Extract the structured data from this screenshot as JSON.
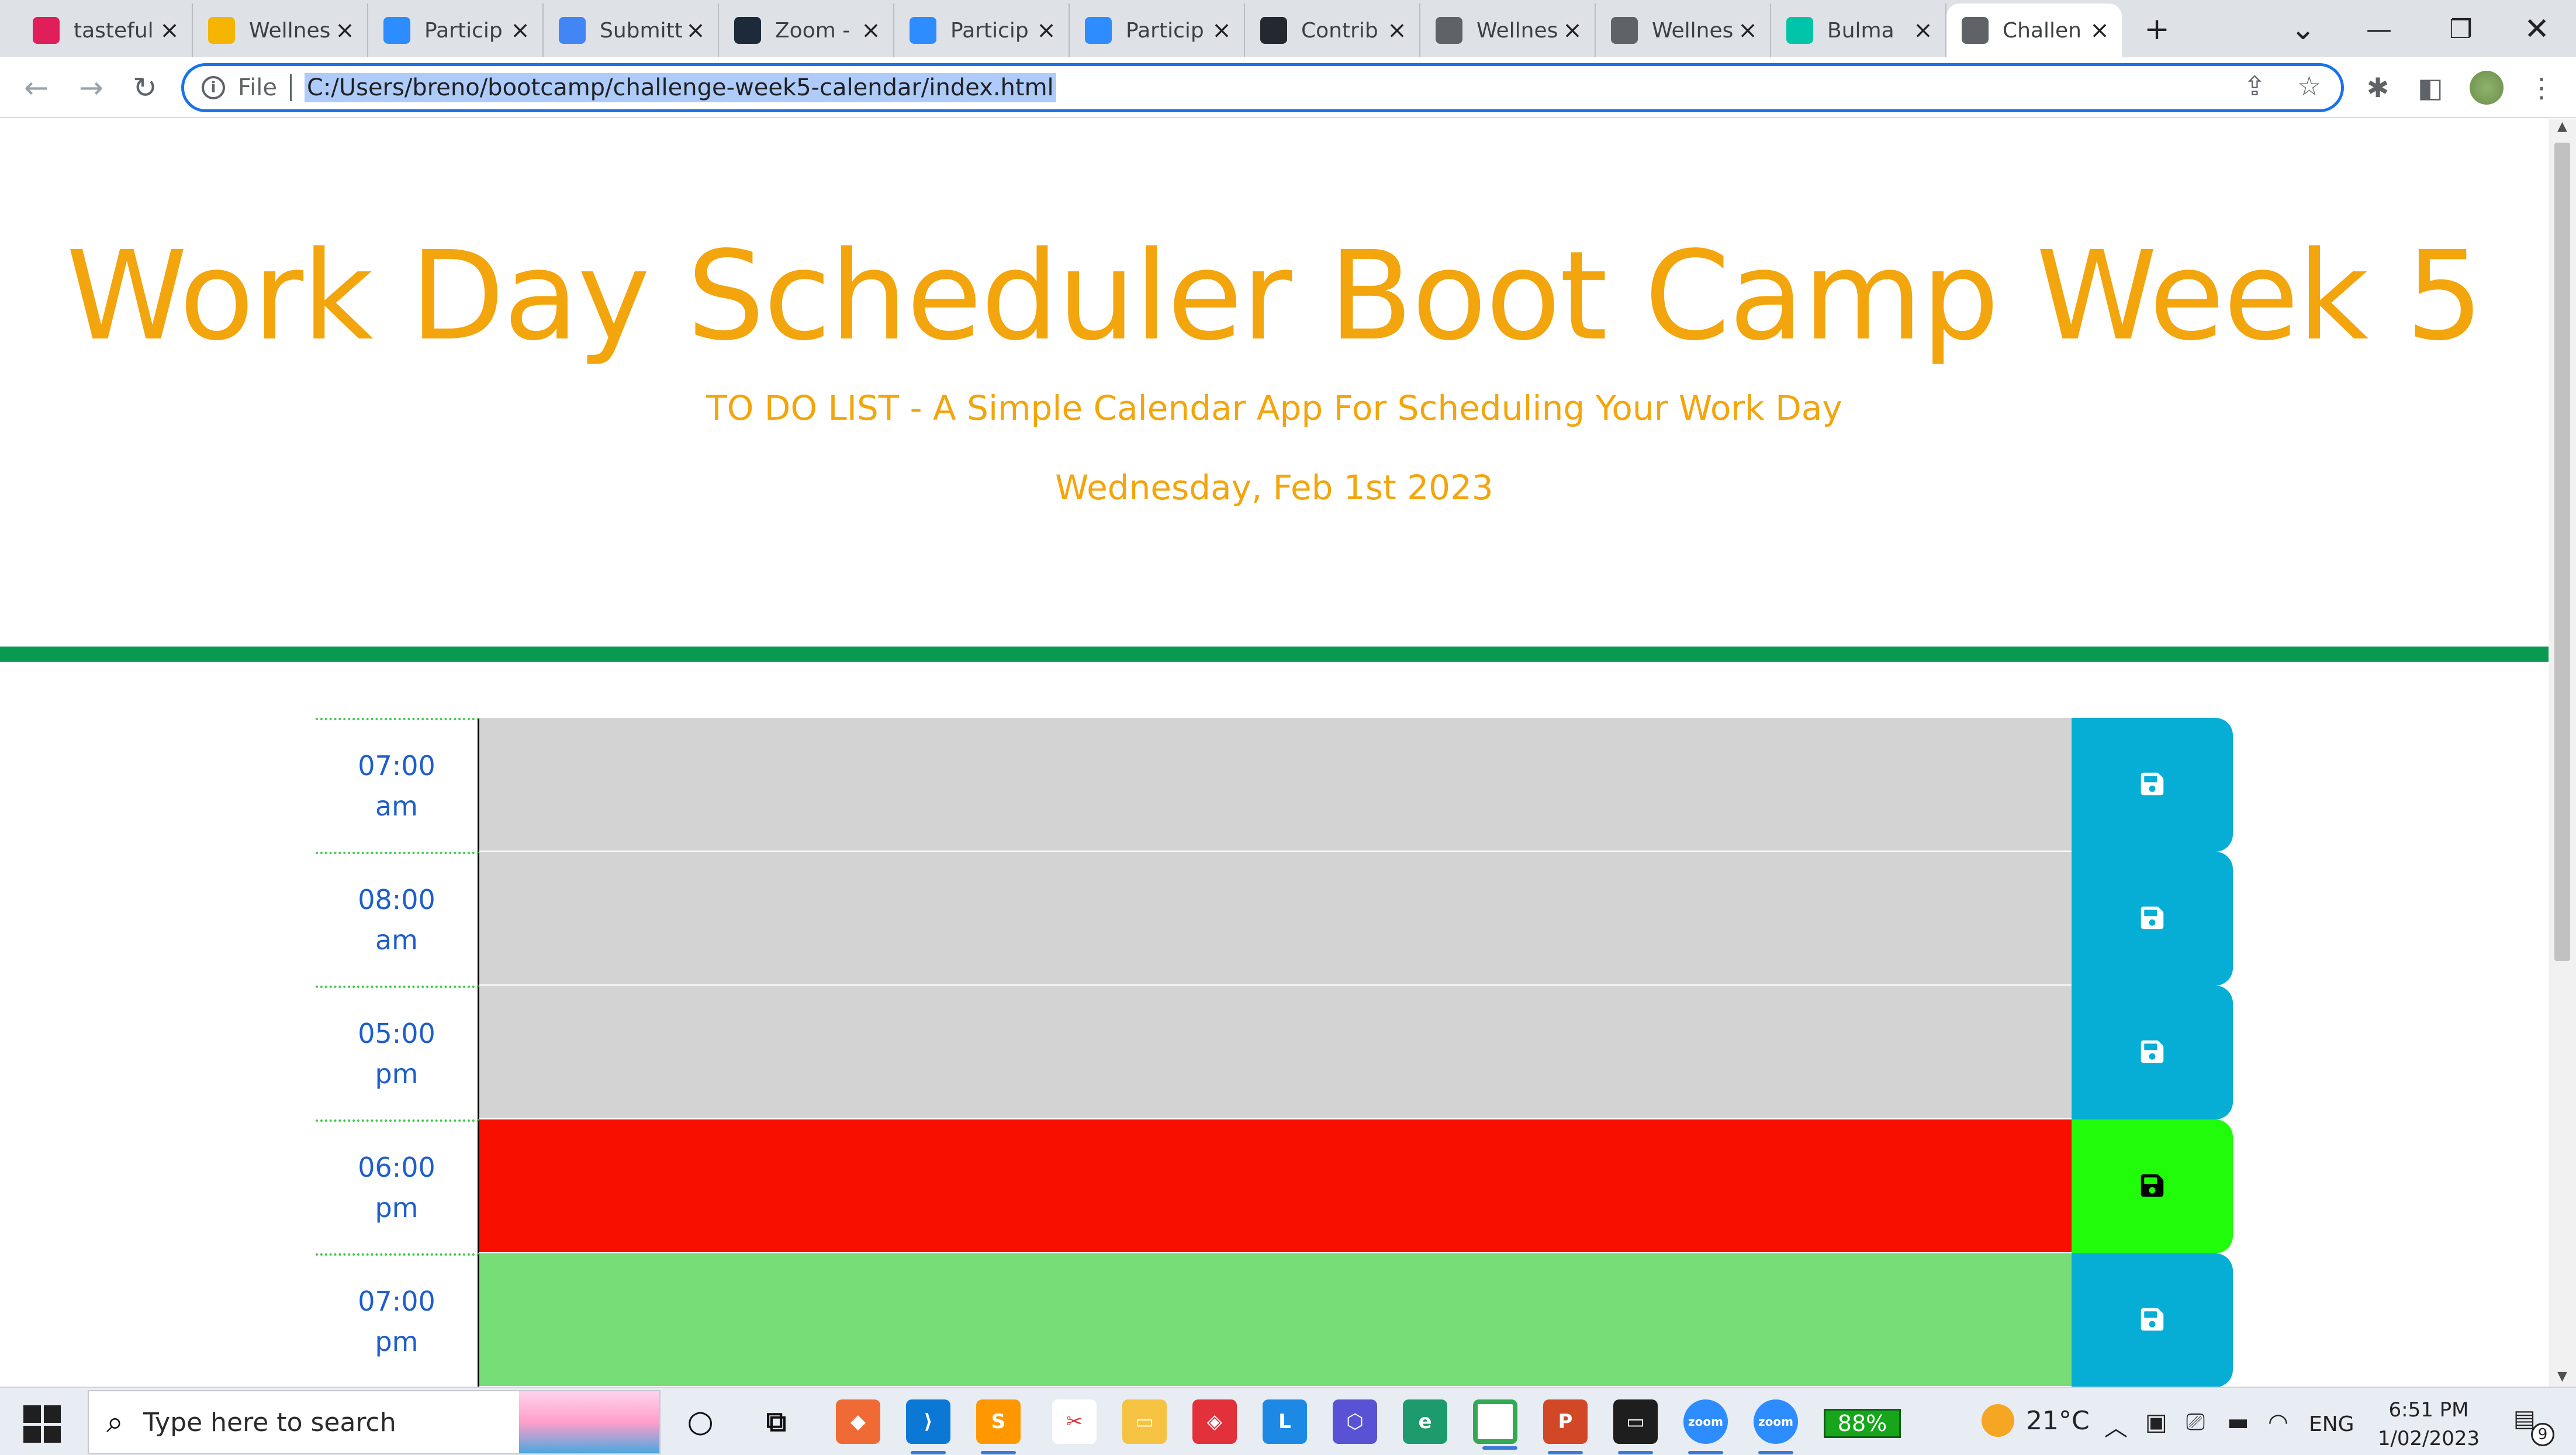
{
  "browser": {
    "tabs": [
      {
        "title": "tasteful",
        "icon": "slack-icon",
        "color": "#e01e5a"
      },
      {
        "title": "Wellnes",
        "icon": "slides-icon",
        "color": "#f4b400"
      },
      {
        "title": "Particip",
        "icon": "zoom-icon",
        "color": "#2d8cff"
      },
      {
        "title": "Submitt",
        "icon": "docs-icon",
        "color": "#4285f4"
      },
      {
        "title": "Zoom -",
        "icon": "zoom-video-icon",
        "color": "#1c2a3a"
      },
      {
        "title": "Particip",
        "icon": "zoom-icon",
        "color": "#2d8cff"
      },
      {
        "title": "Particip",
        "icon": "zoom-icon",
        "color": "#2d8cff"
      },
      {
        "title": "Contrib",
        "icon": "github-icon",
        "color": "#24292f"
      },
      {
        "title": "Wellnes",
        "icon": "globe-icon",
        "color": "#5f6368"
      },
      {
        "title": "Wellnes",
        "icon": "globe-icon",
        "color": "#5f6368"
      },
      {
        "title": "Bulma",
        "icon": "bulma-icon",
        "color": "#00c4a7"
      },
      {
        "title": "Challen",
        "icon": "globe-icon",
        "color": "#5f6368"
      }
    ],
    "new_tab_label": "+",
    "omnibox": {
      "scheme": "File",
      "url": "C:/Users/breno/bootcamp/challenge-week5-calendar/index.html"
    }
  },
  "page": {
    "title": "Work Day Scheduler Boot Camp Week 5",
    "subtitle": "TO DO LIST - A Simple Calendar App For Scheduling Your Work Day",
    "current_day": "Wednesday, Feb 1st 2023",
    "colors": {
      "accent": "#f2a50c",
      "divider": "#0a9950",
      "past": "#d3d3d3",
      "present": "#f90f00",
      "future": "#77dd77",
      "save": "#06aed5",
      "save_active": "#21fc0a"
    },
    "time_blocks": [
      {
        "hour": "07:00",
        "period": "am",
        "state": "past",
        "text": ""
      },
      {
        "hour": "08:00",
        "period": "am",
        "state": "past",
        "text": ""
      },
      {
        "hour": "05:00",
        "period": "pm",
        "state": "past",
        "text": ""
      },
      {
        "hour": "06:00",
        "period": "pm",
        "state": "present",
        "text": ""
      },
      {
        "hour": "07:00",
        "period": "pm",
        "state": "future",
        "text": ""
      }
    ]
  },
  "taskbar": {
    "search_placeholder": "Type here to search",
    "battery": "88%",
    "temperature": "21°C",
    "language": "ENG",
    "time": "6:51 PM",
    "date": "1/02/2023",
    "notification_count": "9"
  }
}
